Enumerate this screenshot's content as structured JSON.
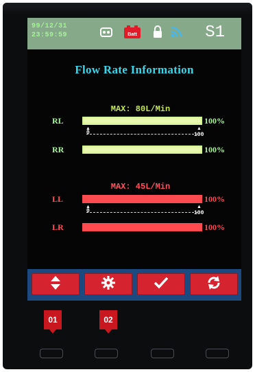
{
  "status_bar": {
    "date": "99/12/31",
    "time": "23:59:59",
    "indicator_label": "S1",
    "icons": [
      "engine-icon",
      "battery-icon",
      "lock-icon",
      "wifi-icon"
    ],
    "battery_label": "Batt"
  },
  "title": "Flow Rate Information",
  "groups": [
    {
      "id": "rear",
      "max_label": "MAX: 80L/Min",
      "color": "#a7f29a",
      "rows": [
        {
          "label": "RL",
          "value_pct": 100,
          "pct_text": "100%"
        },
        {
          "label": "RR",
          "value_pct": 100,
          "pct_text": "100%"
        }
      ],
      "scale": {
        "min": "0",
        "max": "100"
      }
    },
    {
      "id": "front",
      "max_label": "MAX: 45L/Min",
      "color": "#ff4b55",
      "rows": [
        {
          "label": "LL",
          "value_pct": 100,
          "pct_text": "100%"
        },
        {
          "label": "LR",
          "value_pct": 100,
          "pct_text": "100%"
        }
      ],
      "scale": {
        "min": "0",
        "max": "100"
      }
    }
  ],
  "toolbar": {
    "buttons": [
      {
        "name": "up-down-button",
        "icon": "up-down-arrows-icon"
      },
      {
        "name": "settings-button",
        "icon": "gear-icon"
      },
      {
        "name": "confirm-button",
        "icon": "checkmark-icon"
      },
      {
        "name": "refresh-button",
        "icon": "refresh-icon"
      }
    ]
  },
  "callouts": [
    "01",
    "02"
  ],
  "colors": {
    "status_bar": "#86a98a",
    "title": "#3ad6ea",
    "toolbar": "#1c4a80",
    "button": "#d62330",
    "callout": "#c8171f"
  }
}
